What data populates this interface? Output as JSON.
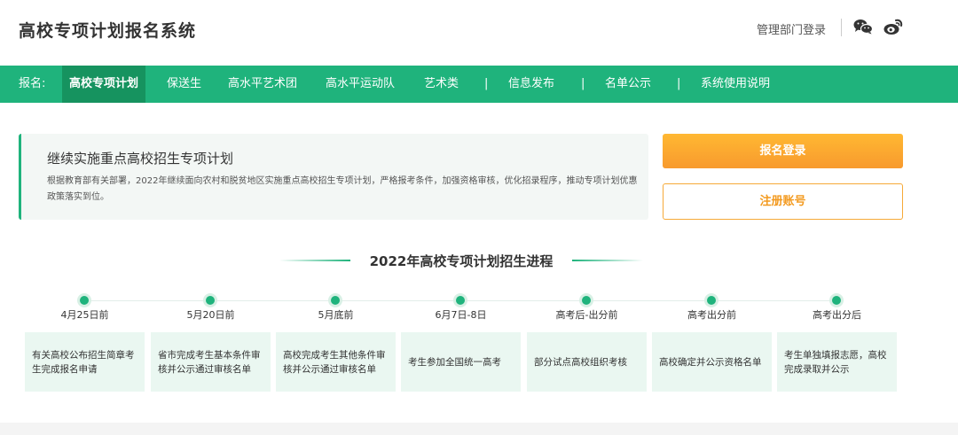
{
  "header": {
    "site_title": "高校专项计划报名系统",
    "admin_login": "管理部门登录",
    "icons": [
      "wechat-icon",
      "weibo-icon"
    ]
  },
  "nav": {
    "prefix": "报名:",
    "items": [
      {
        "label": "高校专项计划",
        "active": true
      },
      {
        "label": "保送生"
      },
      {
        "label": "高水平艺术团"
      },
      {
        "label": "高水平运动队"
      },
      {
        "label": "艺术类"
      },
      {
        "label": "信息发布"
      },
      {
        "label": "名单公示"
      },
      {
        "label": "系统使用说明"
      }
    ],
    "separator": "|"
  },
  "intro": {
    "title": "继续实施重点高校招生专项计划",
    "body": "根据教育部有关部署，2022年继续面向农村和脱贫地区实施重点高校招生专项计划，严格报考条件，加强资格审核，优化招录程序，推动专项计划优惠政策落实到位。"
  },
  "actions": {
    "login": "报名登录",
    "register": "注册账号"
  },
  "timeline": {
    "title": "2022年高校专项计划招生进程",
    "steps": [
      {
        "date": "4月25日前",
        "text": "有关高校公布招生简章考生完成报名申请"
      },
      {
        "date": "5月20日前",
        "text": "省市完成考生基本条件审核并公示通过审核名单"
      },
      {
        "date": "5月底前",
        "text": "高校完成考生其他条件审核并公示通过审核名单"
      },
      {
        "date": "6月7日-8日",
        "text": "考生参加全国统一高考"
      },
      {
        "date": "高考后-出分前",
        "text": "部分试点高校组织考核"
      },
      {
        "date": "高考出分前",
        "text": "高校确定并公示资格名单"
      },
      {
        "date": "高考出分后",
        "text": "考生单独填报志愿，高校完成录取并公示"
      }
    ]
  },
  "colors": {
    "brand_green": "#1fb37c",
    "active_nav": "#16935f",
    "orange": "#f89a2e"
  }
}
